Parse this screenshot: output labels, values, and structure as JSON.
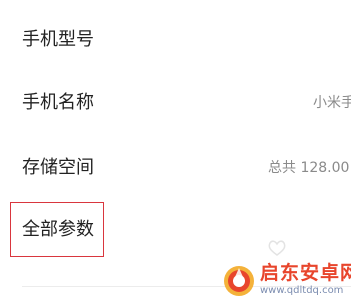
{
  "settings": {
    "rows": [
      {
        "label": "手机型号",
        "value": ""
      },
      {
        "label": "手机名称",
        "value": "小米手"
      },
      {
        "label": "存储空间",
        "value": "总共 128.00"
      },
      {
        "label": "全部参数",
        "value": ""
      }
    ]
  },
  "watermark": {
    "title": "启东安卓网",
    "url": "www.qdltdq.com"
  },
  "colors": {
    "highlight": "#d9363e",
    "watermark_title": "#e8452c",
    "watermark_url": "#7c8db0"
  }
}
